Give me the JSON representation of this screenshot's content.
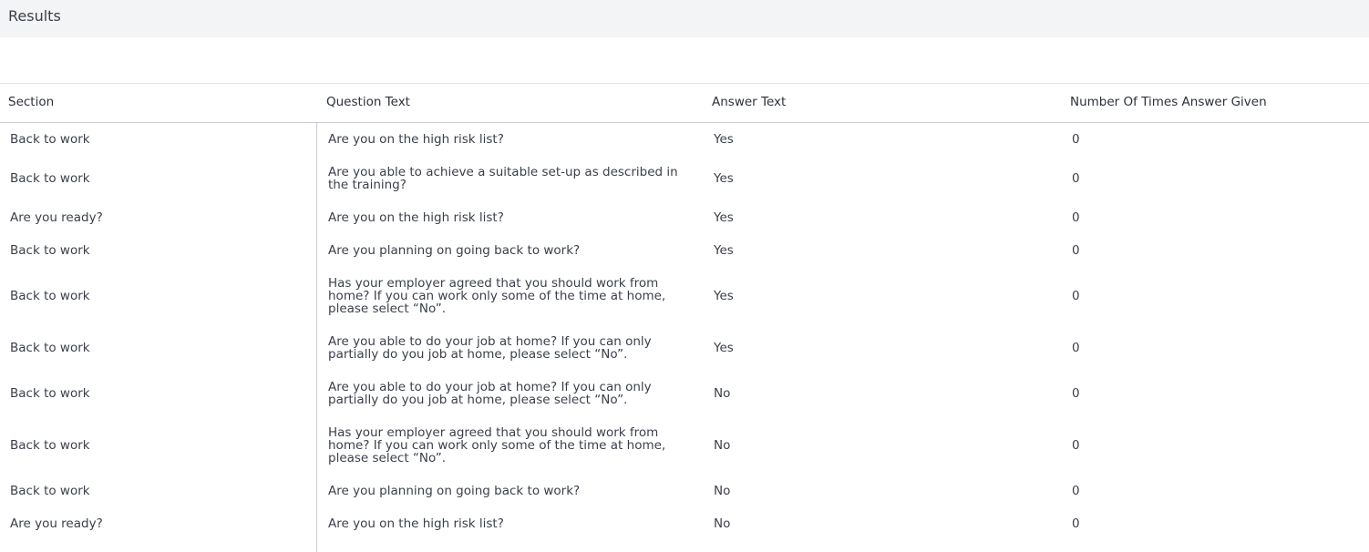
{
  "page": {
    "title": "Results"
  },
  "table": {
    "columns": [
      "Section",
      "Question Text",
      "Answer Text",
      "Number Of Times Answer Given"
    ],
    "rows": [
      {
        "section": "Back to work",
        "question": "Are you on the high risk list?",
        "answer": "Yes",
        "count": "0"
      },
      {
        "section": "Back to work",
        "question": "Are you able to achieve a suitable set-up as described in the training?",
        "answer": "Yes",
        "count": "0"
      },
      {
        "section": "Are you ready?",
        "question": "Are you on the high risk list?",
        "answer": "Yes",
        "count": "0"
      },
      {
        "section": "Back to work",
        "question": "Are you planning on going back to work?",
        "answer": "Yes",
        "count": "0"
      },
      {
        "section": "Back to work",
        "question": "Has your employer agreed that you should work from home? If you can work only some of the time at home, please select “No”.",
        "answer": "Yes",
        "count": "0"
      },
      {
        "section": "Back to work",
        "question": "Are you able to do your job at home? If you can only partially do you job at home, please select “No”.",
        "answer": "Yes",
        "count": "0"
      },
      {
        "section": "Back to work",
        "question": "Are you able to do your job at home? If you can only partially do you job at home, please select “No”.",
        "answer": "No",
        "count": "0"
      },
      {
        "section": "Back to work",
        "question": "Has your employer agreed that you should work from home? If you can work only some of the time at home, please select “No”.",
        "answer": "No",
        "count": "0"
      },
      {
        "section": "Back to work",
        "question": "Are you planning on going back to work?",
        "answer": "No",
        "count": "0"
      },
      {
        "section": "Are you ready?",
        "question": "Are you on the high risk list?",
        "answer": "No",
        "count": "0"
      }
    ]
  }
}
